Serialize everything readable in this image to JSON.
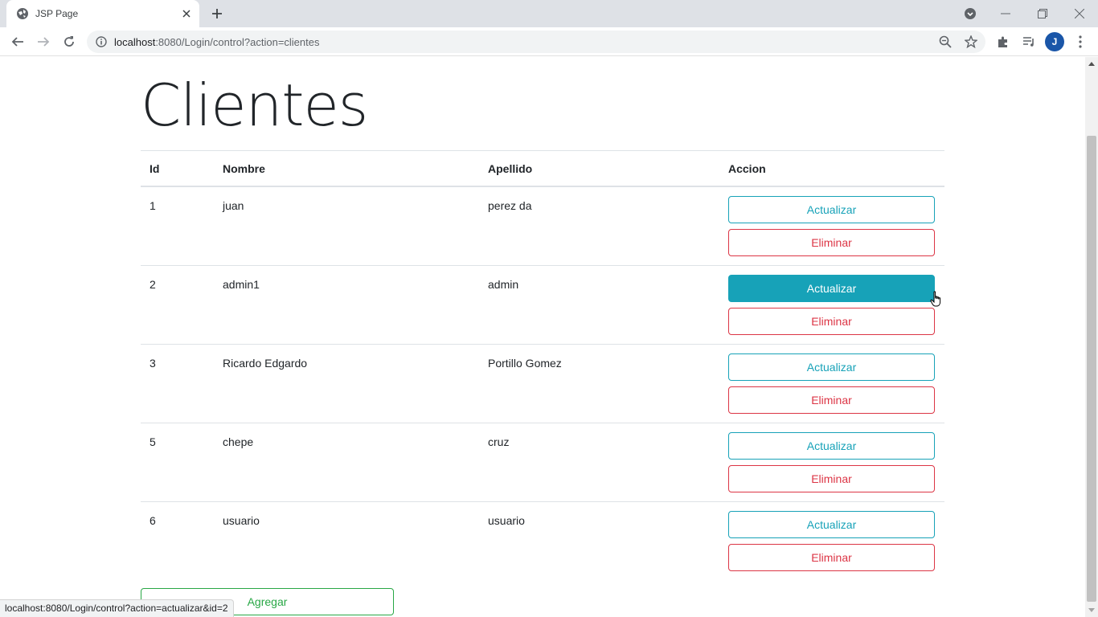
{
  "browser": {
    "tab_title": "JSP Page",
    "url_host": "localhost",
    "url_rest": ":8080/Login/control?action=clientes",
    "profile_initial": "J",
    "status_url": "localhost:8080/Login/control?action=actualizar&id=2"
  },
  "page": {
    "title": "Clientes",
    "columns": [
      "Id",
      "Nombre",
      "Apellido",
      "Accion"
    ],
    "rows": [
      {
        "id": "1",
        "nombre": "juan",
        "apellido": "perez da",
        "update_label": "Actualizar",
        "delete_label": "Eliminar",
        "hovered": false
      },
      {
        "id": "2",
        "nombre": "admin1",
        "apellido": "admin",
        "update_label": "Actualizar",
        "delete_label": "Eliminar",
        "hovered": true
      },
      {
        "id": "3",
        "nombre": "Ricardo Edgardo",
        "apellido": "Portillo Gomez",
        "update_label": "Actualizar",
        "delete_label": "Eliminar",
        "hovered": false
      },
      {
        "id": "5",
        "nombre": "chepe",
        "apellido": "cruz",
        "update_label": "Actualizar",
        "delete_label": "Eliminar",
        "hovered": false
      },
      {
        "id": "6",
        "nombre": "usuario",
        "apellido": "usuario",
        "update_label": "Actualizar",
        "delete_label": "Eliminar",
        "hovered": false
      }
    ],
    "add_label": "Agregar"
  },
  "colors": {
    "info": "#17a2b8",
    "danger": "#dc3545",
    "success": "#28a745"
  }
}
